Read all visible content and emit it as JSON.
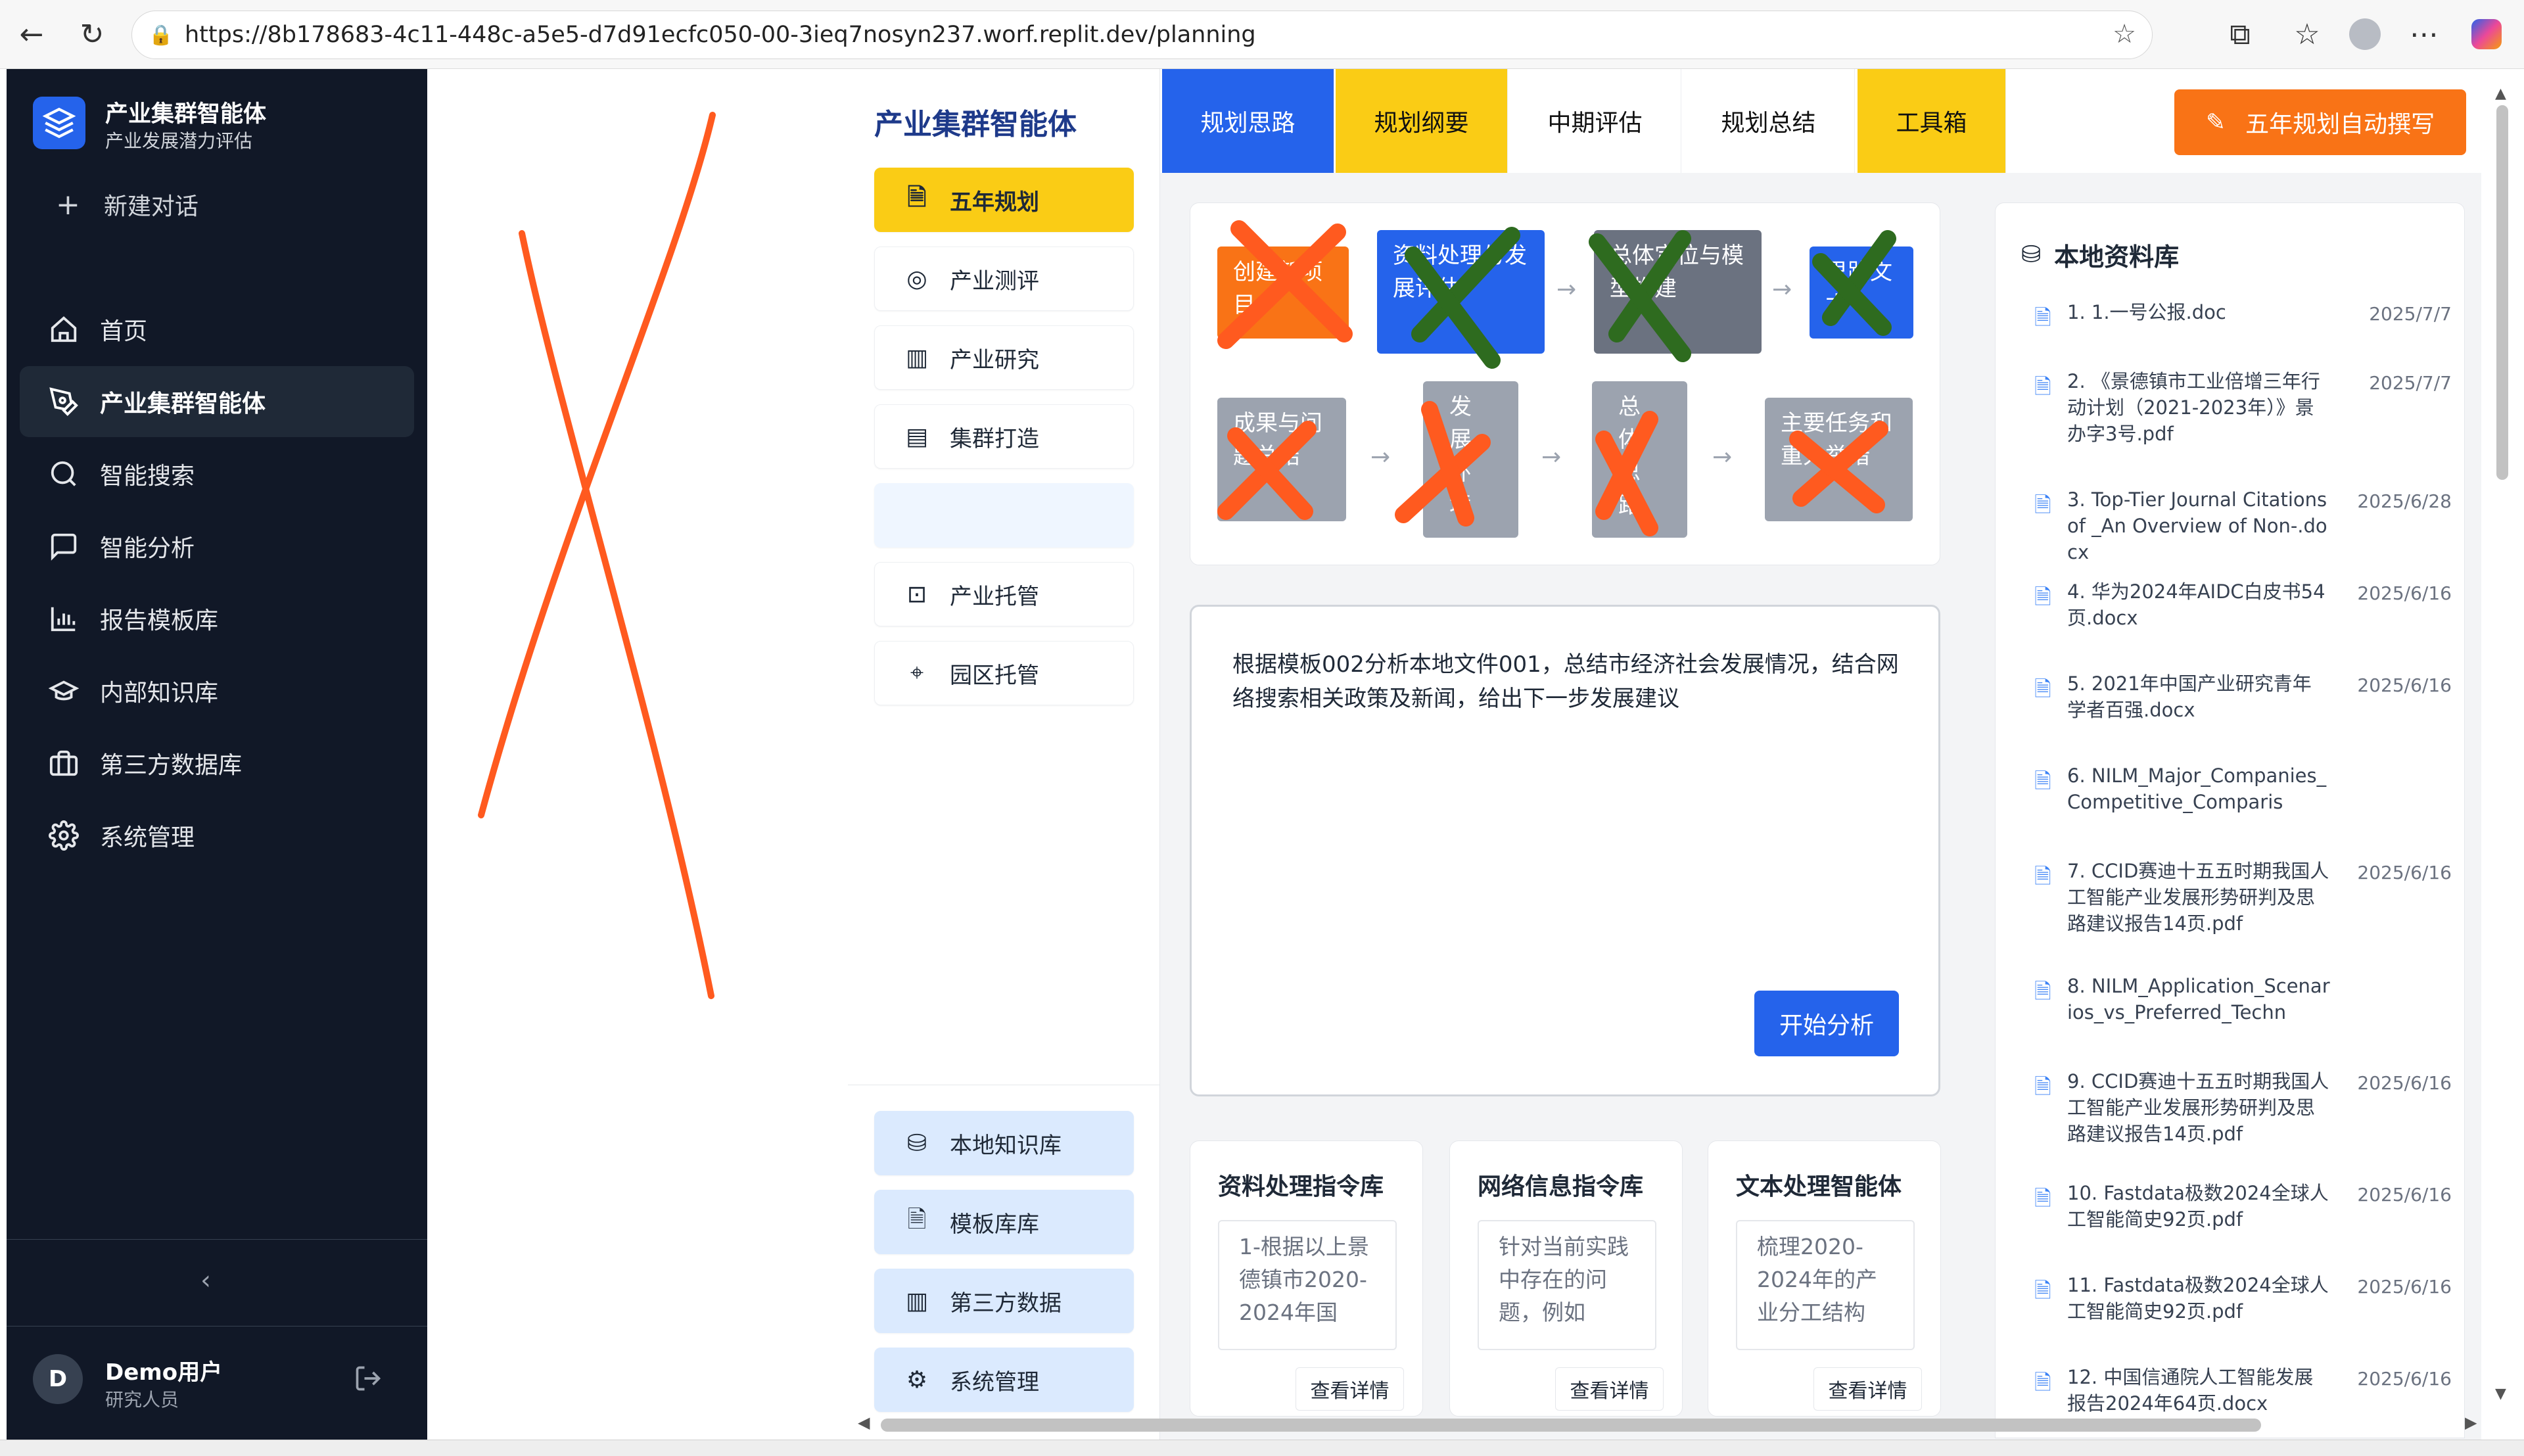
{
  "browser": {
    "url": "https://8b178683-4c11-448c-a5e5-d7d91ecfc050-00-3ieq7nosyn237.worf.replit.dev/planning"
  },
  "sidebar": {
    "app_title": "产业集群智能体",
    "app_subtitle": "产业发展潜力评估",
    "new_chat": "新建对话",
    "items": [
      {
        "label": "首页",
        "icon": "home-icon"
      },
      {
        "label": "产业集群智能体",
        "icon": "pen-tool-icon"
      },
      {
        "label": "智能搜索",
        "icon": "search-icon"
      },
      {
        "label": "智能分析",
        "icon": "message-icon"
      },
      {
        "label": "报告模板库",
        "icon": "bar-chart-icon"
      },
      {
        "label": "内部知识库",
        "icon": "graduation-cap-icon"
      },
      {
        "label": "第三方数据库",
        "icon": "briefcase-icon"
      },
      {
        "label": "系统管理",
        "icon": "gear-icon"
      }
    ],
    "collapse": "‹",
    "user": {
      "avatar": "D",
      "name": "Demo用户",
      "role": "研究人员"
    }
  },
  "panel": {
    "title": "产业集群智能体",
    "menu": [
      "五年规划",
      "产业测评",
      "产业研究",
      "集群打造",
      "",
      "产业托管",
      "园区托管"
    ],
    "bottom": [
      "本地知识库",
      "模板库库",
      "第三方数据",
      "系统管理"
    ]
  },
  "tabs": [
    "规划思路",
    "规划纲要",
    "中期评估",
    "规划总结",
    "工具箱"
  ],
  "auto_button": "五年规划自动撰写",
  "flow": {
    "row1": [
      "创建新项目",
      "资料处理与发展评估",
      "总体定位与模型构建",
      "思路文本"
    ],
    "row2": [
      "成果与问题总结",
      "发展环境",
      "总体思路",
      "主要任务和重大举措"
    ]
  },
  "prompt": {
    "text": "根据模板002分析本地文件001，总结市经济社会发展情况，结合网络搜索相关政策及新闻，给出下一步发展建议",
    "start_button": "开始分析"
  },
  "libs": [
    {
      "title": "资料处理指令库",
      "content": "1-根据以上景德镇市2020-2024年国",
      "button": "查看详情"
    },
    {
      "title": "网络信息指令库",
      "content": "针对当前实践中存在的问题，例如",
      "button": "查看详情"
    },
    {
      "title": "文本处理智能体",
      "content": "梳理2020-2024年的产业分工结构",
      "button": "查看详情"
    }
  ],
  "library": {
    "title": "本地资料库",
    "items": [
      {
        "name": "1. 1.一号公报.doc",
        "date": "2025/7/7"
      },
      {
        "name": "2. 《景德镇市工业倍增三年行动计划（2021-2023年）》景办字3号.pdf",
        "date": "2025/7/7"
      },
      {
        "name": "3. Top-Tier Journal Citations of _An Overview of Non-.docx",
        "date": "2025/6/28"
      },
      {
        "name": "4. 华为2024年AIDC白皮书54页.docx",
        "date": "2025/6/16"
      },
      {
        "name": "5. 2021年中国产业研究青年学者百强.docx",
        "date": "2025/6/16"
      },
      {
        "name": "6. NILM_Major_Companies_Competitive_Comparis",
        "date": ""
      },
      {
        "name": "7. CCID赛迪十五五时期我国人工智能产业发展形势研判及思路建议报告14页.pdf",
        "date": "2025/6/16"
      },
      {
        "name": "8. NILM_Application_Scenarios_vs_Preferred_Techn",
        "date": ""
      },
      {
        "name": "9. CCID赛迪十五五时期我国人工智能产业发展形势研判及思路建议报告14页.pdf",
        "date": "2025/6/16"
      },
      {
        "name": "10. Fastdata极数2024全球人工智能简史92页.pdf",
        "date": "2025/6/16"
      },
      {
        "name": "11. Fastdata极数2024全球人工智能简史92页.pdf",
        "date": "2025/6/16"
      },
      {
        "name": "12. 中国信通院人工智能发展报告2024年64页.docx",
        "date": "2025/6/16"
      }
    ]
  }
}
